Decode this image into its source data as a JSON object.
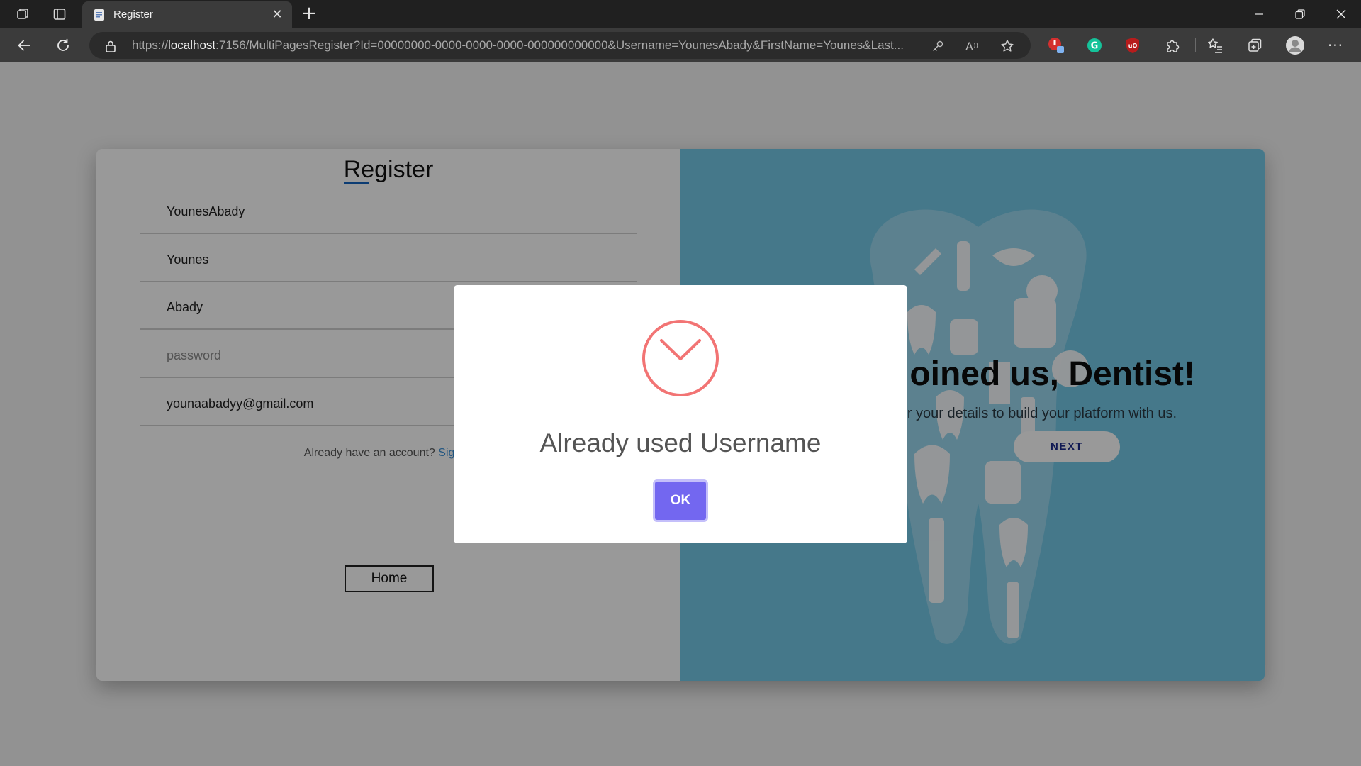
{
  "browser": {
    "tab_title": "Register",
    "url_scheme": "https://",
    "url_host": "localhost",
    "url_rest": ":7156/MultiPagesRegister?Id=00000000-0000-0000-0000-000000000000&Username=YounesAbady&FirstName=Younes&Last..."
  },
  "form": {
    "title": "Register",
    "username": "YounesAbady",
    "first_name": "Younes",
    "last_name": "Abady",
    "password_placeholder": "password",
    "email": "younaabadyy@gmail.com",
    "already_text": "Already have an account?",
    "sign_in_link": "Sign in",
    "home_button": "Home"
  },
  "hero": {
    "heading": "Glad you joined us, Dentist!",
    "subheading": "Enter your details to build your platform with us.",
    "next_button": "NEXT"
  },
  "dialog": {
    "message": "Already used Username",
    "ok_button": "OK",
    "icon": "clock-icon",
    "icon_color": "#f27474",
    "ok_color": "#7367f0"
  },
  "colors": {
    "panel_blue": "#74c8e7"
  }
}
